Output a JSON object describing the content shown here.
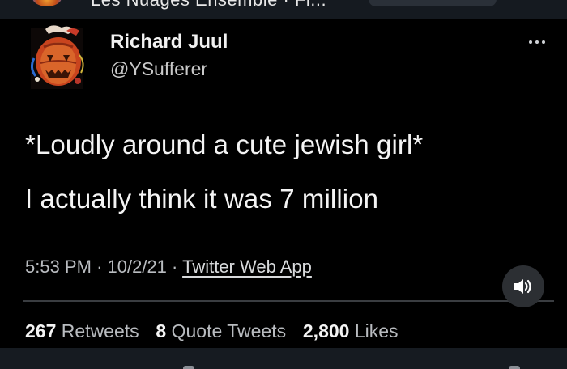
{
  "top_bar": {
    "cropped_title": "Les Nuages Ensemble · Fi..."
  },
  "tweet": {
    "author": {
      "name": "Richard Juul",
      "handle": "@YSufferer",
      "avatar_icon": "jack-o-lantern-avatar-icon"
    },
    "more_icon": "more-options-icon",
    "text_lines": [
      "*Loudly around a cute jewish girl*",
      "I actually think it was 7 million"
    ],
    "timestamp": {
      "time": "5:53 PM",
      "separator": "·",
      "date": "10/2/21",
      "source": "Twitter Web App"
    },
    "stats": {
      "retweets_count": "267",
      "retweets_label": "Retweets",
      "quote_tweets_count": "8",
      "quote_tweets_label": "Quote Tweets",
      "likes_count": "2,800",
      "likes_label": "Likes"
    }
  },
  "video_overlay": {
    "sound_icon": "speaker-volume-icon"
  },
  "colors": {
    "background": "#000000",
    "top_bar": "#151a20",
    "text_primary": "#f4f4f4",
    "text_secondary": "#b9bcc0",
    "divider": "#3a3d41",
    "sound_button": "#2c2f33"
  }
}
